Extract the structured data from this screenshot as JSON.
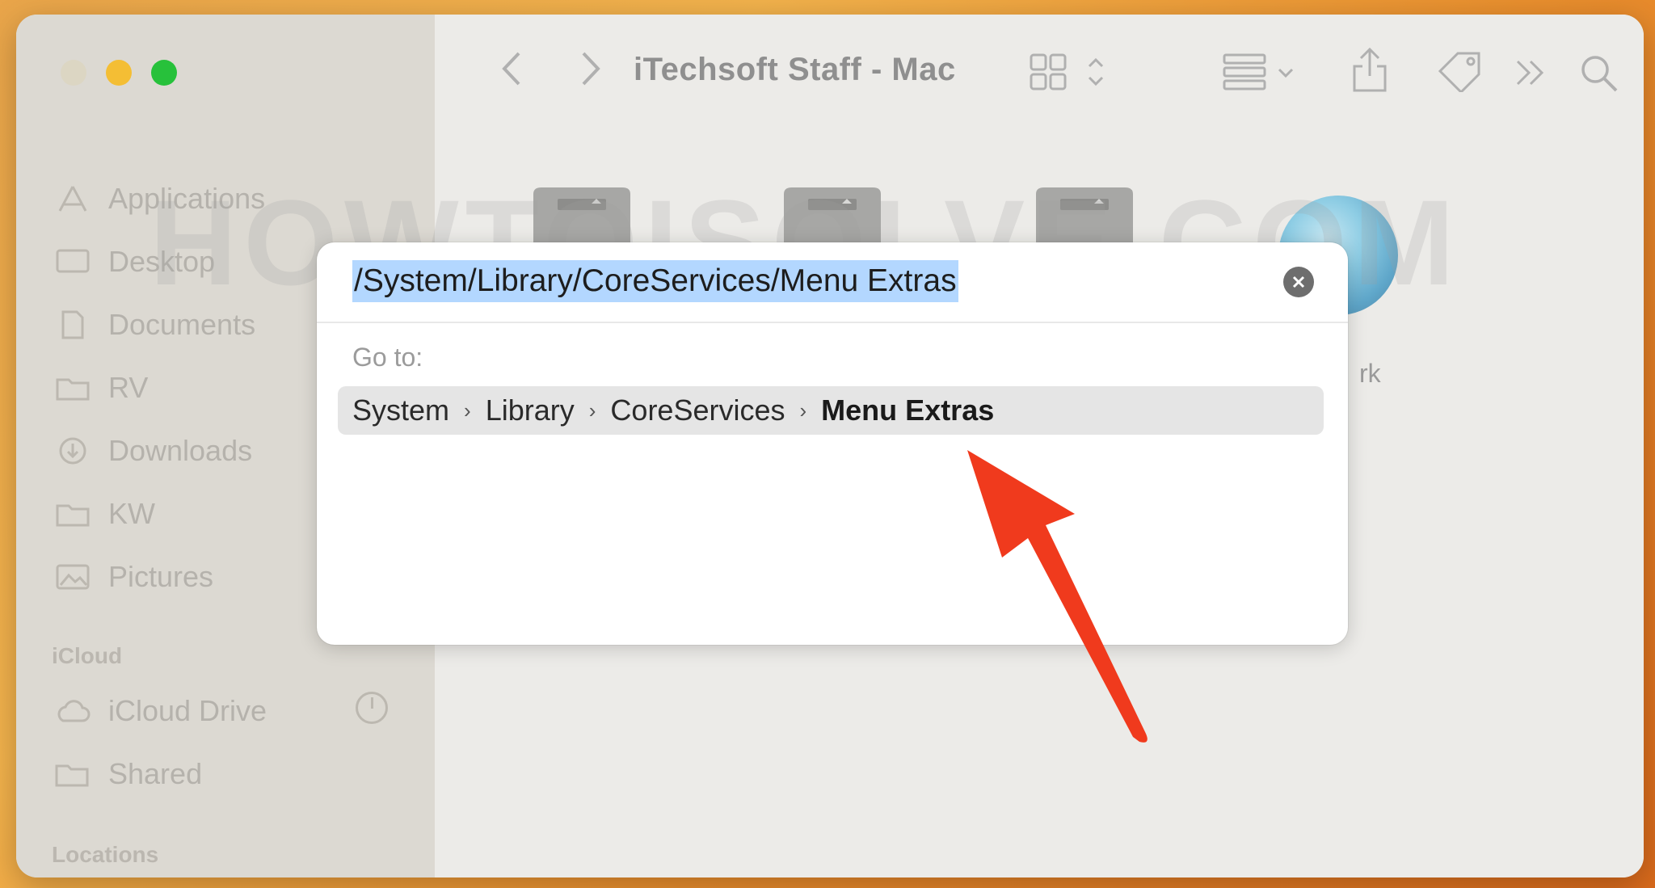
{
  "window": {
    "title": "iTechsoft Staff - Mac",
    "watermark": "HOWTOISOLVE.COM"
  },
  "sidebar": {
    "items": [
      {
        "label": "Applications",
        "icon": "applications-icon"
      },
      {
        "label": "Desktop",
        "icon": "desktop-icon"
      },
      {
        "label": "Documents",
        "icon": "documents-icon"
      },
      {
        "label": "RV",
        "icon": "folder-icon"
      },
      {
        "label": "Downloads",
        "icon": "downloads-icon"
      },
      {
        "label": "KW",
        "icon": "folder-icon"
      },
      {
        "label": "Pictures",
        "icon": "pictures-icon"
      }
    ],
    "sections": {
      "icloud": "iCloud",
      "locations": "Locations"
    },
    "icloud_items": [
      {
        "label": "iCloud Drive",
        "icon": "cloud-icon"
      },
      {
        "label": "Shared",
        "icon": "shared-folder-icon"
      }
    ]
  },
  "content": {
    "partial_label": "rk"
  },
  "dialog": {
    "path_value": "/System/Library/CoreServices/Menu Extras",
    "goto_label": "Go to:",
    "breadcrumb": [
      "System",
      "Library",
      "CoreServices",
      "Menu Extras"
    ]
  },
  "colors": {
    "selection": "#b3d7ff",
    "arrow": "#f03a1d",
    "traffic_yellow": "#f4be34",
    "traffic_green": "#27c13b"
  }
}
